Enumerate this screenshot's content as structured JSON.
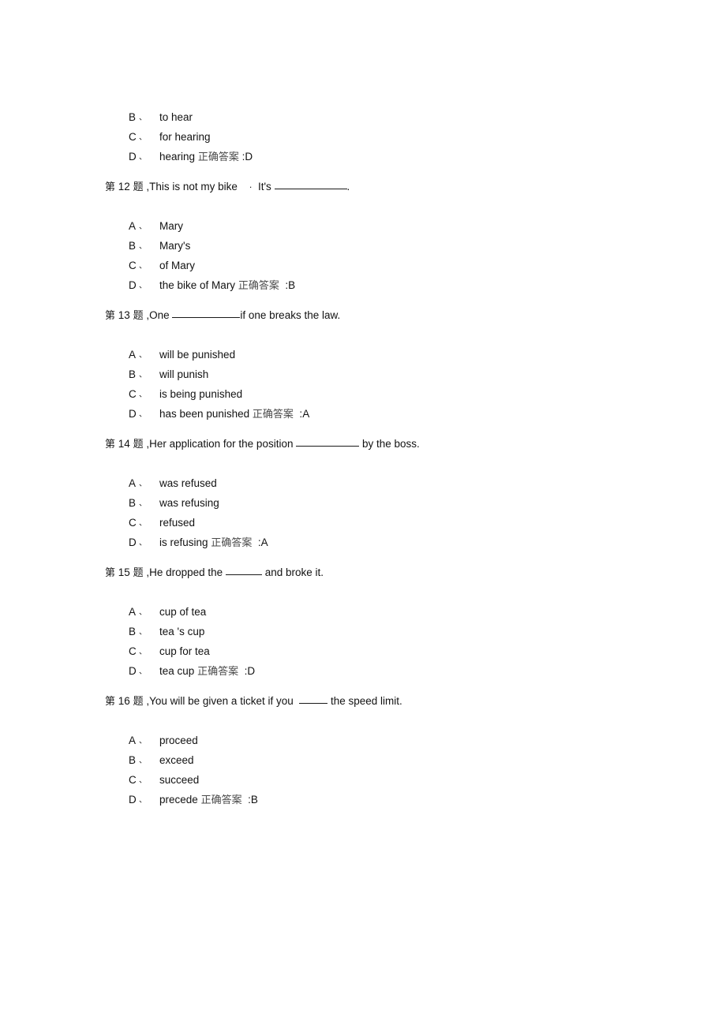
{
  "document": {
    "type": "exam-question-sheet",
    "language": "zh-CN + en",
    "question_prefix_cn": "第",
    "question_suffix_cn": "题",
    "answer_label_cn": "正确答案",
    "option_separator": "、",
    "answer_colon": ":"
  },
  "continuation_block": {
    "note": "tail options of question 11 carried over from previous page",
    "options": [
      {
        "letter": "B",
        "text": "to hear"
      },
      {
        "letter": "C",
        "text": "for hearing"
      },
      {
        "letter": "D",
        "text": "hearing"
      }
    ],
    "answer": "D",
    "answer_on_option": "D"
  },
  "questions": [
    {
      "number": "12",
      "stem_before": ",This is not my bike",
      "stem_middot": "·",
      "stem_mid": "It's",
      "blank_size": "xl",
      "stem_after": ".",
      "options": [
        {
          "letter": "A",
          "text": "Mary"
        },
        {
          "letter": "B",
          "text": "Mary's"
        },
        {
          "letter": "C",
          "text": "of Mary"
        },
        {
          "letter": "D",
          "text": "the bike of Mary"
        }
      ],
      "answer": "B"
    },
    {
      "number": "13",
      "stem_before": ",One",
      "stem_middot": "",
      "stem_mid": "",
      "blank_size": "lg",
      "stem_after": "if one breaks the law.",
      "options": [
        {
          "letter": "A",
          "text": "will be punished"
        },
        {
          "letter": "B",
          "text": "will punish"
        },
        {
          "letter": "C",
          "text": "is being punished"
        },
        {
          "letter": "D",
          "text": "has been punished"
        }
      ],
      "answer": "A"
    },
    {
      "number": "14",
      "stem_before": ",Her application for the position",
      "stem_middot": "",
      "stem_mid": "",
      "blank_size": "md",
      "stem_after": " by the boss.",
      "options": [
        {
          "letter": "A",
          "text": "was refused"
        },
        {
          "letter": "B",
          "text": "was refusing"
        },
        {
          "letter": "C",
          "text": "refused"
        },
        {
          "letter": "D",
          "text": "is refusing"
        }
      ],
      "answer": "A"
    },
    {
      "number": "15",
      "stem_before": ",He dropped the",
      "stem_middot": "",
      "stem_mid": "",
      "blank_size": "sm",
      "stem_after": " and broke it.",
      "options": [
        {
          "letter": "A",
          "text": "cup of tea"
        },
        {
          "letter": "B",
          "text": "tea 's cup"
        },
        {
          "letter": "C",
          "text": "cup for tea"
        },
        {
          "letter": "D",
          "text": "tea cup"
        }
      ],
      "answer": "D"
    },
    {
      "number": "16",
      "stem_before": ",You will be given a ticket if you",
      "stem_middot": "",
      "stem_mid": "",
      "blank_size": "xs",
      "stem_after": " the speed limit.",
      "options": [
        {
          "letter": "A",
          "text": "proceed"
        },
        {
          "letter": "B",
          "text": "exceed"
        },
        {
          "letter": "C",
          "text": "succeed"
        },
        {
          "letter": "D",
          "text": "precede"
        }
      ],
      "answer": "B"
    }
  ]
}
